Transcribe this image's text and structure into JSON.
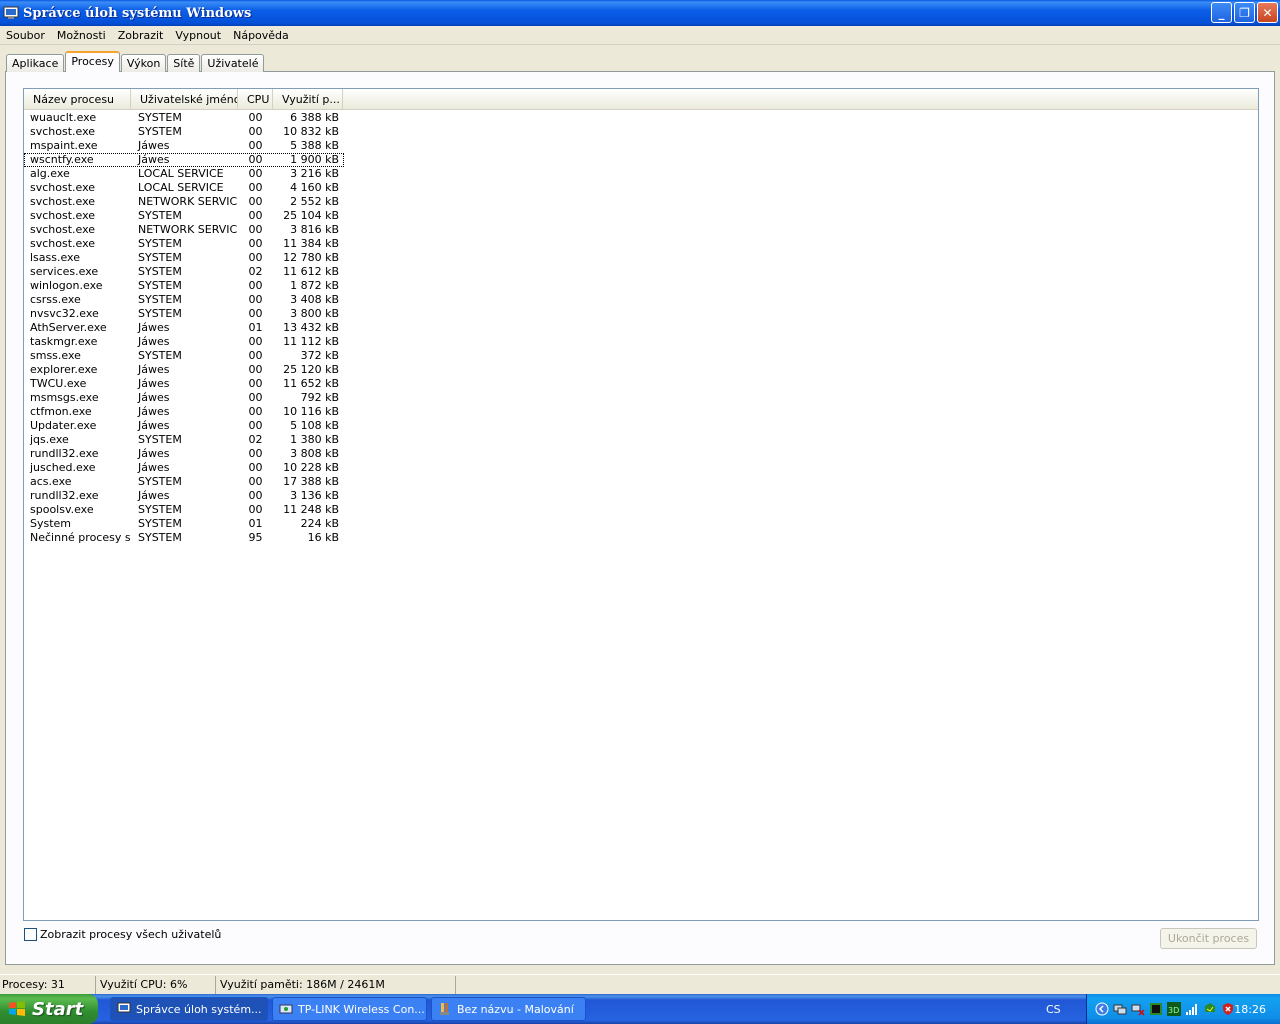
{
  "window": {
    "title": "Správce úloh systému Windows",
    "buttons": {
      "minimize": "_",
      "maximize": "❐",
      "close": "✕"
    }
  },
  "menu": [
    "Soubor",
    "Možnosti",
    "Zobrazit",
    "Vypnout",
    "Nápověda"
  ],
  "tabs": [
    {
      "label": "Aplikace",
      "active": false
    },
    {
      "label": "Procesy",
      "active": true
    },
    {
      "label": "Výkon",
      "active": false
    },
    {
      "label": "Sítě",
      "active": false
    },
    {
      "label": "Uživatelé",
      "active": false
    }
  ],
  "columns": {
    "name": "Název procesu",
    "user": "Uživatelské jméno",
    "cpu": "CPU",
    "mem": "Využití p..."
  },
  "processes": [
    [
      "wuauclt.exe",
      "SYSTEM",
      "00",
      "6 388 kB"
    ],
    [
      "svchost.exe",
      "SYSTEM",
      "00",
      "10 832 kB"
    ],
    [
      "mspaint.exe",
      "Jáwes",
      "00",
      "5 388 kB"
    ],
    [
      "wscntfy.exe",
      "Jáwes",
      "00",
      "1 900 kB"
    ],
    [
      "alg.exe",
      "LOCAL SERVICE",
      "00",
      "3 216 kB"
    ],
    [
      "svchost.exe",
      "LOCAL SERVICE",
      "00",
      "4 160 kB"
    ],
    [
      "svchost.exe",
      "NETWORK SERVICE",
      "00",
      "2 552 kB"
    ],
    [
      "svchost.exe",
      "SYSTEM",
      "00",
      "25 104 kB"
    ],
    [
      "svchost.exe",
      "NETWORK SERVICE",
      "00",
      "3 816 kB"
    ],
    [
      "svchost.exe",
      "SYSTEM",
      "00",
      "11 384 kB"
    ],
    [
      "lsass.exe",
      "SYSTEM",
      "00",
      "12 780 kB"
    ],
    [
      "services.exe",
      "SYSTEM",
      "02",
      "11 612 kB"
    ],
    [
      "winlogon.exe",
      "SYSTEM",
      "00",
      "1 872 kB"
    ],
    [
      "csrss.exe",
      "SYSTEM",
      "00",
      "3 408 kB"
    ],
    [
      "nvsvc32.exe",
      "SYSTEM",
      "00",
      "3 800 kB"
    ],
    [
      "AthServer.exe",
      "Jáwes",
      "01",
      "13 432 kB"
    ],
    [
      "taskmgr.exe",
      "Jáwes",
      "00",
      "11 112 kB"
    ],
    [
      "smss.exe",
      "SYSTEM",
      "00",
      "372 kB"
    ],
    [
      "explorer.exe",
      "Jáwes",
      "00",
      "25 120 kB"
    ],
    [
      "TWCU.exe",
      "Jáwes",
      "00",
      "11 652 kB"
    ],
    [
      "msmsgs.exe",
      "Jáwes",
      "00",
      "792 kB"
    ],
    [
      "ctfmon.exe",
      "Jáwes",
      "00",
      "10 116 kB"
    ],
    [
      "Updater.exe",
      "Jáwes",
      "00",
      "5 108 kB"
    ],
    [
      "jqs.exe",
      "SYSTEM",
      "02",
      "1 380 kB"
    ],
    [
      "rundll32.exe",
      "Jáwes",
      "00",
      "3 808 kB"
    ],
    [
      "jusched.exe",
      "Jáwes",
      "00",
      "10 228 kB"
    ],
    [
      "acs.exe",
      "SYSTEM",
      "00",
      "17 388 kB"
    ],
    [
      "rundll32.exe",
      "Jáwes",
      "00",
      "3 136 kB"
    ],
    [
      "spoolsv.exe",
      "SYSTEM",
      "00",
      "11 248 kB"
    ],
    [
      "System",
      "SYSTEM",
      "01",
      "224 kB"
    ],
    [
      "Nečinné procesy s...",
      "SYSTEM",
      "95",
      "16 kB"
    ]
  ],
  "focused_row": 3,
  "show_all_label": "Zobrazit procesy všech uživatelů",
  "show_all_checked": false,
  "end_process_label": "Ukončit proces",
  "status": {
    "processes": "Procesy: 31",
    "cpu": "Využití CPU: 6%",
    "memory": "Využití paměti: 186M / 2461M"
  },
  "taskbar": {
    "start_label": "Start",
    "tasks": [
      {
        "label": "Správce úloh systém...",
        "icon": "taskmgr-icon",
        "active": true
      },
      {
        "label": "TP-LINK Wireless Con...",
        "icon": "wireless-icon",
        "active": false
      },
      {
        "label": "Bez názvu - Malování",
        "icon": "paint-icon",
        "active": false
      }
    ],
    "language": "CS",
    "clock": "18:26",
    "tray_icons": [
      "arrow-left-icon",
      "network-icon",
      "network-icon",
      "nvidia-icon",
      "xfire-icon",
      "signal-icon",
      "antivirus-icon",
      "security-icon"
    ]
  }
}
